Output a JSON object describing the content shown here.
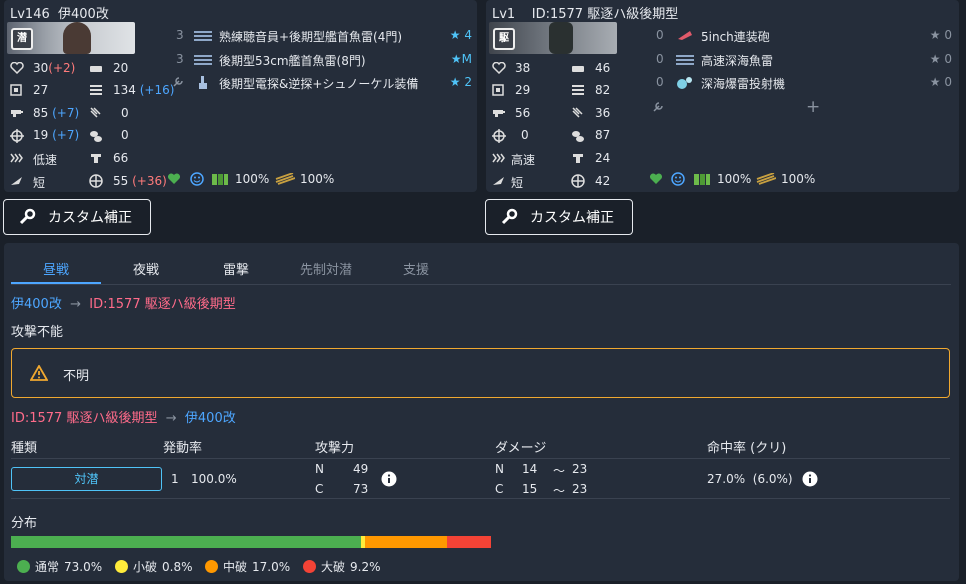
{
  "left": {
    "level": "Lv146",
    "name": "伊400改",
    "stats": {
      "hp": "30",
      "hp_mod": "(+2)",
      "armor": "20",
      "evasion": "27",
      "aa": "134",
      "aa_mod": "(+16)",
      "firepower": "85",
      "firepower_mod": "(+7)",
      "asw": "0",
      "torpedo": "19",
      "torpedo_mod": "(+7)",
      "los": "0",
      "speed": "低速",
      "luck": "66",
      "range": "短",
      "accuracy": "55",
      "accuracy_mod": "(+36)"
    },
    "equipment": [
      {
        "slot": "3",
        "name": "熟練聴音員+後期型艦首魚雷(4門)",
        "star": "★",
        "level": "4"
      },
      {
        "slot": "3",
        "name": "後期型53cm艦首魚雷(8門)",
        "star": "★",
        "level": "M"
      },
      {
        "slot": "",
        "name": "後期型電探&逆探+シュノーケル装備",
        "star": "★",
        "level": "2"
      }
    ],
    "morale_pct": "100%",
    "ammo_pct": "100%"
  },
  "right": {
    "level": "Lv1",
    "name": "ID:1577 駆逐ハ級後期型",
    "stats": {
      "hp": "38",
      "armor": "46",
      "evasion": "29",
      "aa": "82",
      "firepower": "56",
      "asw": "36",
      "torpedo": "0",
      "los": "87",
      "speed": "高速",
      "luck": "24",
      "range": "短",
      "accuracy": "42"
    },
    "equipment": [
      {
        "slot": "0",
        "name": "5inch連装砲",
        "star": "★",
        "level": "0"
      },
      {
        "slot": "0",
        "name": "高速深海魚雷",
        "star": "★",
        "level": "0"
      },
      {
        "slot": "0",
        "name": "深海爆雷投射機",
        "star": "★",
        "level": "0"
      }
    ],
    "add_label": "+",
    "morale_pct": "100%",
    "ammo_pct": "100%"
  },
  "custom_button": "カスタム補正",
  "tabs": [
    "昼戦",
    "夜戦",
    "雷撃",
    "先制対潜",
    "支援"
  ],
  "section1": {
    "attacker": "伊400改",
    "defender": "ID:1577 駆逐ハ級後期型",
    "status": "攻撃不能",
    "warning": "不明"
  },
  "section2": {
    "attacker": "ID:1577 駆逐ハ級後期型",
    "defender": "伊400改",
    "headers": {
      "type": "種類",
      "rate": "発動率",
      "power": "攻撃力",
      "damage": "ダメージ",
      "hit": "命中率 (クリ)"
    },
    "row": {
      "type": "対潜",
      "count": "1",
      "rate": "100.0%",
      "power_n_label": "N",
      "power_n": "49",
      "power_c_label": "C",
      "power_c": "73",
      "dmg_n_label": "N",
      "dmg_n_min": "14",
      "dmg_n_sep": "～",
      "dmg_n_max": "23",
      "dmg_c_label": "C",
      "dmg_c_min": "15",
      "dmg_c_sep": "～",
      "dmg_c_max": "23",
      "hit": "27.0%",
      "crit": "(6.0%)"
    }
  },
  "distribution": {
    "title": "分布",
    "segments": [
      {
        "label": "通常",
        "value": "73.0%",
        "pct": 73.0,
        "color": "#4caf50"
      },
      {
        "label": "小破",
        "value": "0.8%",
        "pct": 0.8,
        "color": "#ffeb3b"
      },
      {
        "label": "中破",
        "value": "17.0%",
        "pct": 17.0,
        "color": "#ff9800"
      },
      {
        "label": "大破",
        "value": "9.2%",
        "pct": 9.2,
        "color": "#f44336"
      }
    ]
  },
  "colors": {
    "accent": "#4da6ff",
    "enemy": "#ff6b8a",
    "warning": "#f0a830",
    "star": "#4fc3f7"
  }
}
